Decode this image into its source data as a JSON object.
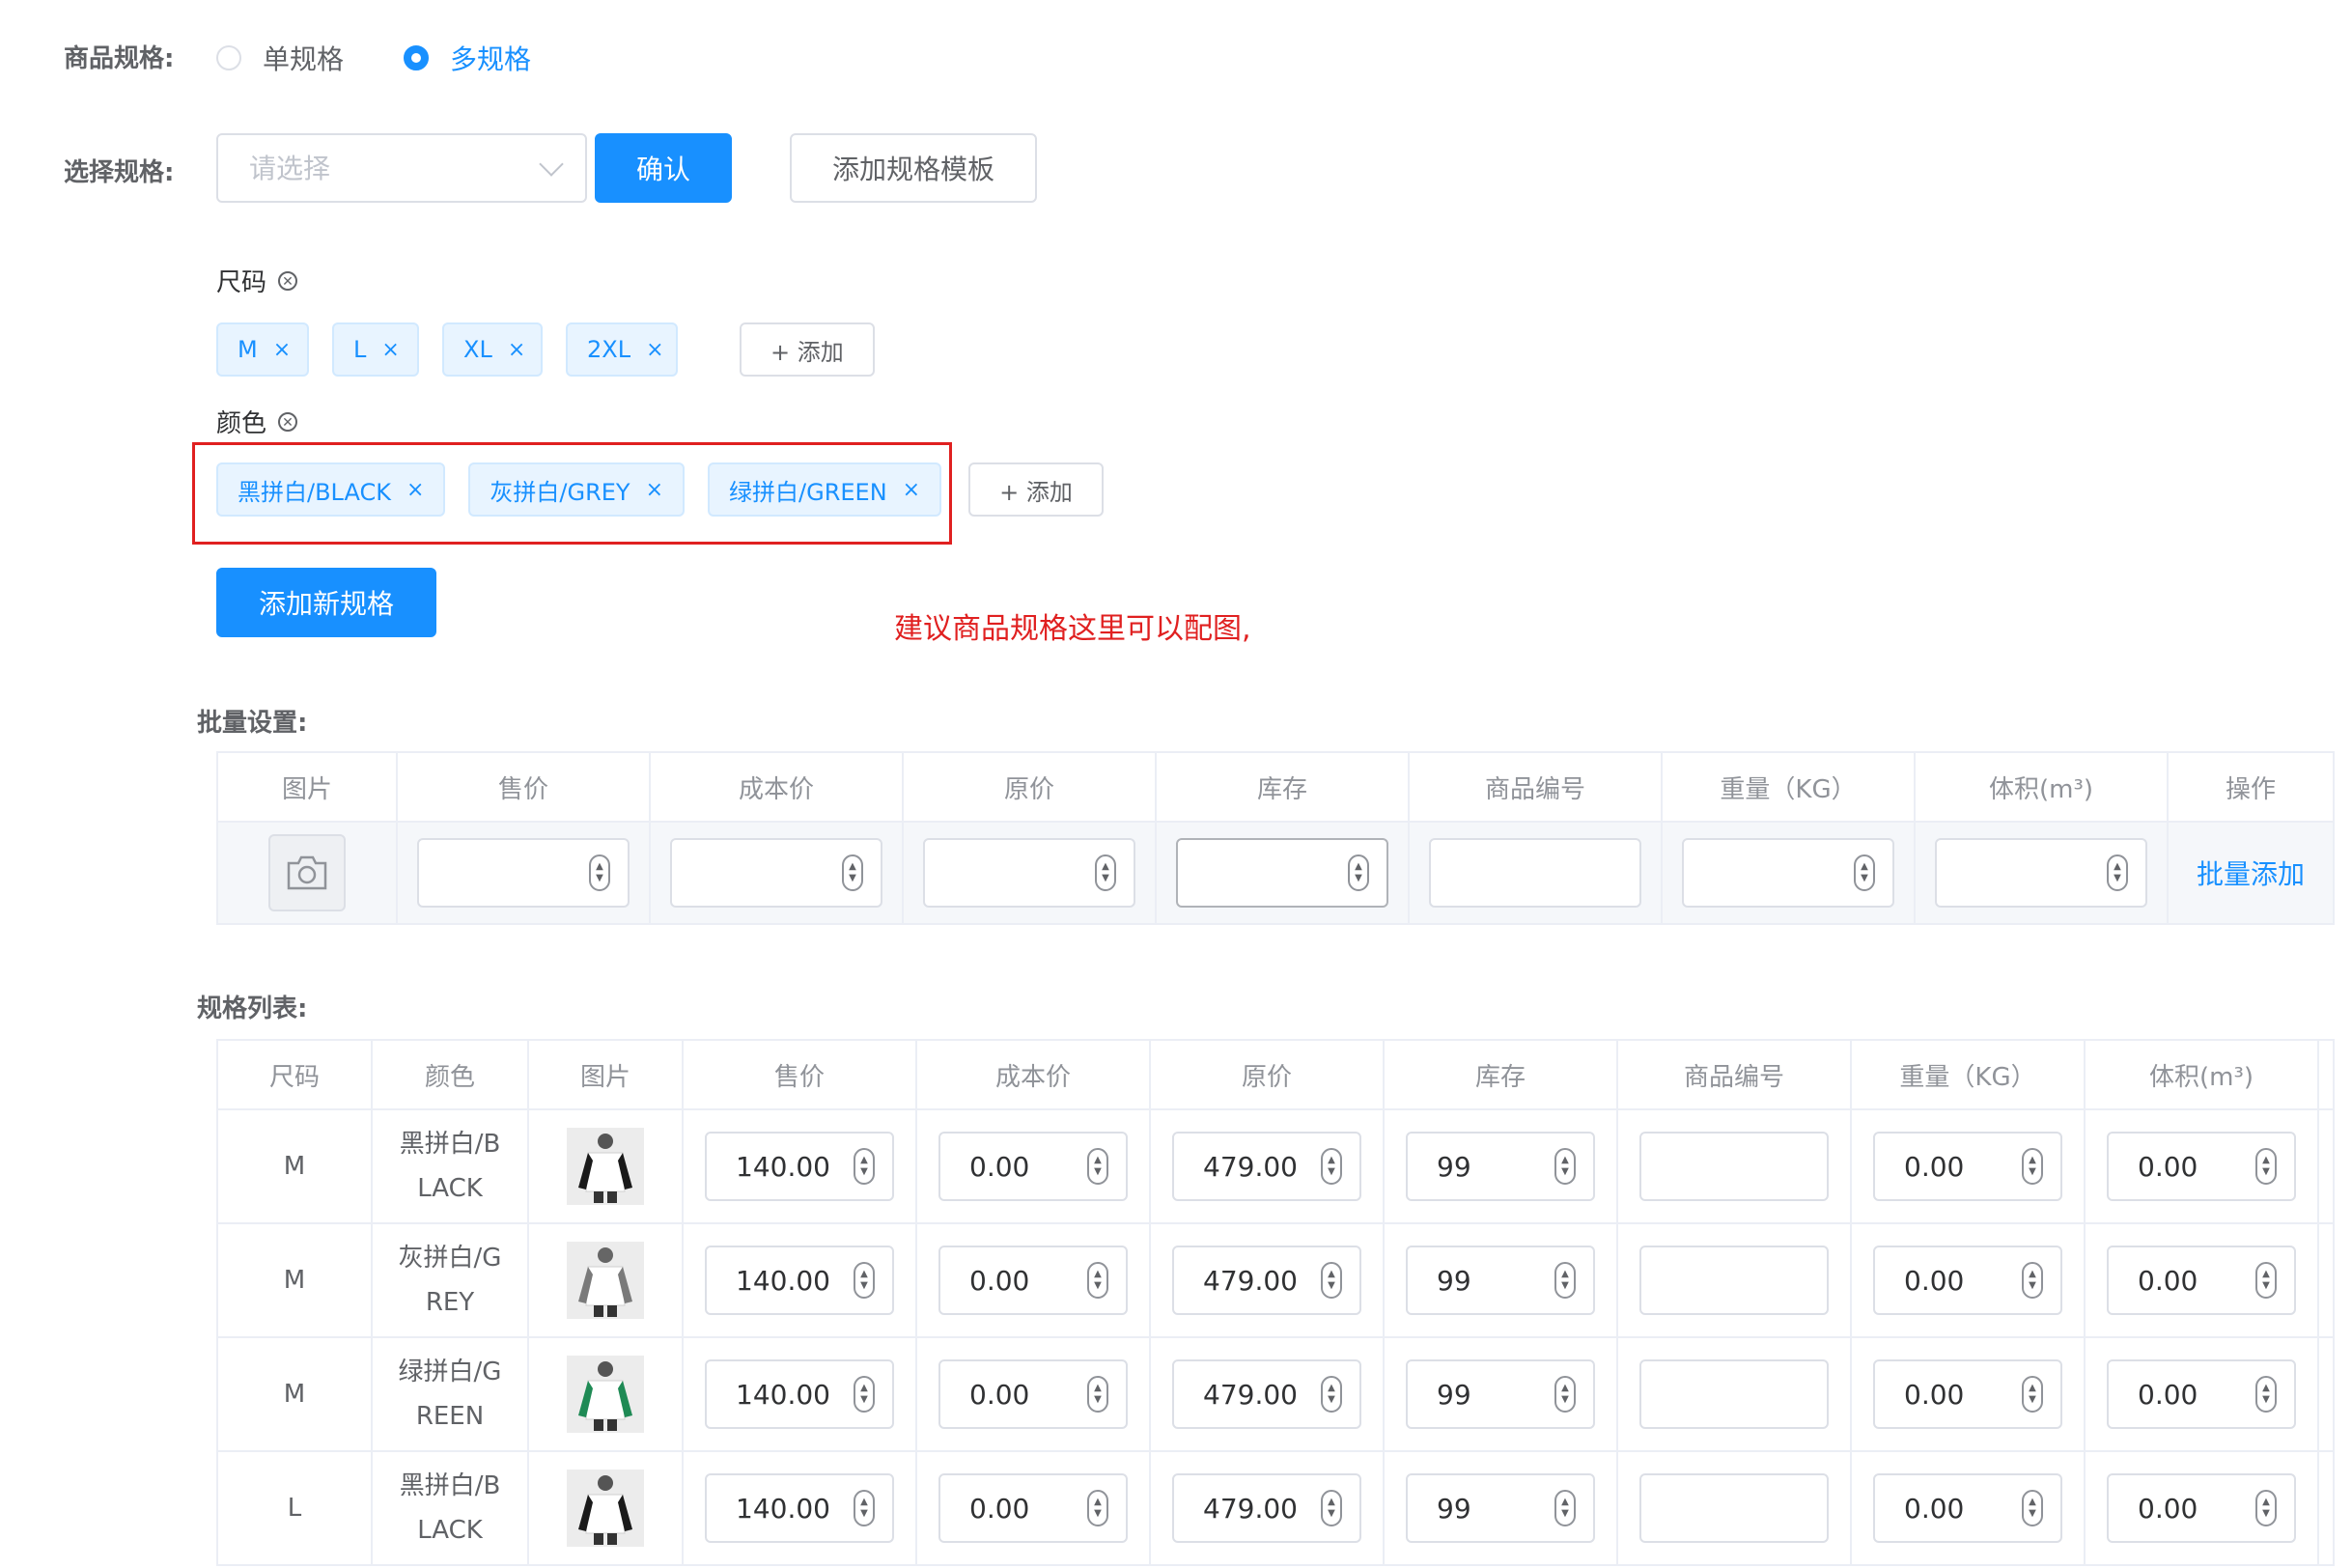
{
  "spec_type": {
    "label": "商品规格:",
    "options": [
      {
        "label": "单规格",
        "checked": false
      },
      {
        "label": "多规格",
        "checked": true
      }
    ]
  },
  "select_spec": {
    "label": "选择规格:",
    "placeholder": "请选择",
    "confirm_label": "确认",
    "add_template_label": "添加规格模板"
  },
  "groups": [
    {
      "title": "尺码",
      "tags": [
        "M",
        "L",
        "XL",
        "2XL"
      ],
      "add_label": "+ 添加"
    },
    {
      "title": "颜色",
      "tags": [
        "黑拼白/BLACK",
        "灰拼白/GREY",
        "绿拼白/GREEN"
      ],
      "add_label": "+ 添加"
    }
  ],
  "add_new_spec_label": "添加新规格",
  "annotation": "建议商品规格这里可以配图,",
  "colors": {
    "accent": "#1890ff",
    "annotation_red": "#e02020",
    "tag_bg": "#e8f4ff"
  },
  "batch": {
    "title": "批量设置:",
    "headers": [
      "图片",
      "售价",
      "成本价",
      "原价",
      "库存",
      "商品编号",
      "重量（KG）",
      "体积(m³)",
      "操作"
    ],
    "action_label": "批量添加"
  },
  "spec_list": {
    "title": "规格列表:",
    "headers": [
      "尺码",
      "颜色",
      "图片",
      "售价",
      "成本价",
      "原价",
      "库存",
      "商品编号",
      "重量（KG）",
      "体积(m³)"
    ],
    "rows": [
      {
        "size": "M",
        "color_l1": "黑拼白/B",
        "color_l2": "LACK",
        "thumb": "black",
        "price": "140.00",
        "cost": "0.00",
        "original": "479.00",
        "stock": "99",
        "weight": "0.00",
        "volume": "0.00"
      },
      {
        "size": "M",
        "color_l1": "灰拼白/G",
        "color_l2": "REY",
        "thumb": "grey",
        "price": "140.00",
        "cost": "0.00",
        "original": "479.00",
        "stock": "99",
        "weight": "0.00",
        "volume": "0.00"
      },
      {
        "size": "M",
        "color_l1": "绿拼白/G",
        "color_l2": "REEN",
        "thumb": "green",
        "price": "140.00",
        "cost": "0.00",
        "original": "479.00",
        "stock": "99",
        "weight": "0.00",
        "volume": "0.00"
      },
      {
        "size": "L",
        "color_l1": "黑拼白/B",
        "color_l2": "LACK",
        "thumb": "black",
        "price": "140.00",
        "cost": "0.00",
        "original": "479.00",
        "stock": "99",
        "weight": "0.00",
        "volume": "0.00"
      }
    ]
  }
}
